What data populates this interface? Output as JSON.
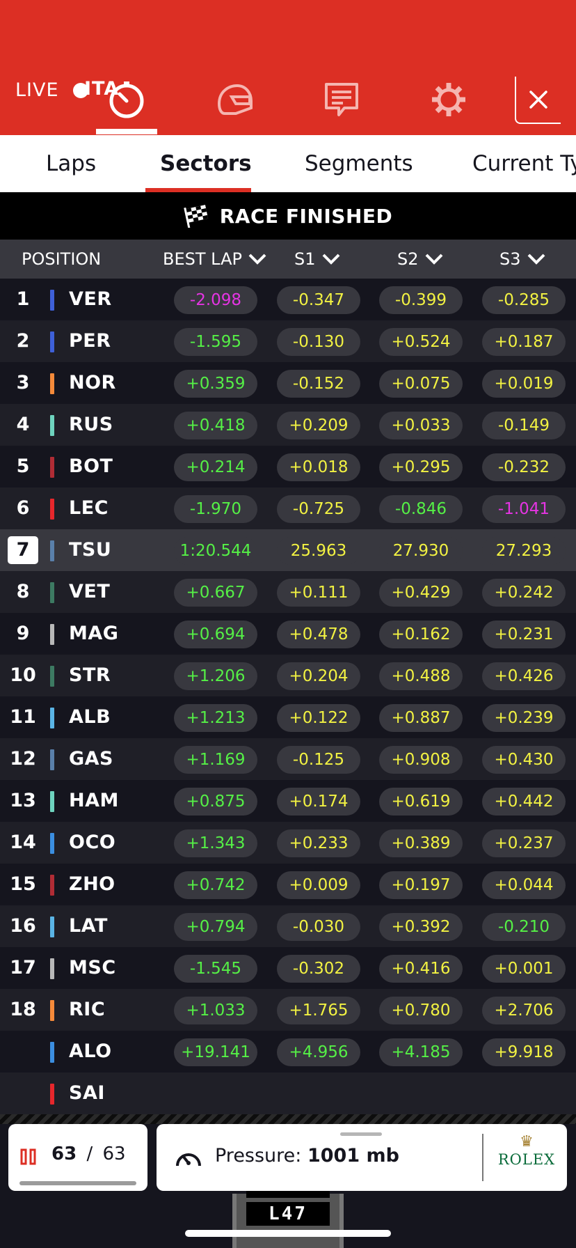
{
  "header": {
    "session_code": "ITA",
    "live_label": "LIVE",
    "icons": [
      "timer-icon",
      "helmet-icon",
      "chat-icon",
      "settings-icon",
      "close-icon"
    ],
    "colors": {
      "brand_red": "#dc2f24",
      "white": "#ffffff"
    }
  },
  "tabs": [
    {
      "label": "Laps"
    },
    {
      "label": "Sectors",
      "active": true
    },
    {
      "label": "Segments"
    },
    {
      "label": "Current Ty"
    }
  ],
  "status": {
    "text": "RACE FINISHED",
    "icon": "checkered-flag-icon"
  },
  "columns": {
    "position": "POSITION",
    "best_lap": "BEST LAP",
    "s1": "S1",
    "s2": "S2",
    "s3": "S3"
  },
  "value_colors": {
    "green": "#55f046",
    "yellow": "#f2f242",
    "purple": "#e534e3"
  },
  "drivers": [
    {
      "pos": "1",
      "code": "VER",
      "team_color": "#3e60d8",
      "best": "-2.098",
      "best_c": "purple",
      "s1": "-0.347",
      "s1_c": "yellow",
      "s2": "-0.399",
      "s2_c": "yellow",
      "s3": "-0.285",
      "s3_c": "yellow"
    },
    {
      "pos": "2",
      "code": "PER",
      "team_color": "#3e60d8",
      "best": "-1.595",
      "best_c": "green",
      "s1": "-0.130",
      "s1_c": "yellow",
      "s2": "+0.524",
      "s2_c": "yellow",
      "s3": "+0.187",
      "s3_c": "yellow"
    },
    {
      "pos": "3",
      "code": "NOR",
      "team_color": "#f58a3a",
      "best": "+0.359",
      "best_c": "green",
      "s1": "-0.152",
      "s1_c": "yellow",
      "s2": "+0.075",
      "s2_c": "yellow",
      "s3": "+0.019",
      "s3_c": "yellow"
    },
    {
      "pos": "4",
      "code": "RUS",
      "team_color": "#6ed3be",
      "best": "+0.418",
      "best_c": "green",
      "s1": "+0.209",
      "s1_c": "yellow",
      "s2": "+0.033",
      "s2_c": "yellow",
      "s3": "-0.149",
      "s3_c": "yellow"
    },
    {
      "pos": "5",
      "code": "BOT",
      "team_color": "#b02c35",
      "best": "+0.214",
      "best_c": "green",
      "s1": "+0.018",
      "s1_c": "yellow",
      "s2": "+0.295",
      "s2_c": "yellow",
      "s3": "-0.232",
      "s3_c": "yellow"
    },
    {
      "pos": "6",
      "code": "LEC",
      "team_color": "#e6272c",
      "best": "-1.970",
      "best_c": "green",
      "s1": "-0.725",
      "s1_c": "yellow",
      "s2": "-0.846",
      "s2_c": "green",
      "s3": "-1.041",
      "s3_c": "purple"
    },
    {
      "pos": "7",
      "code": "TSU",
      "team_color": "#5a80aa",
      "best": "1:20.544",
      "best_c": "green",
      "s1": "25.963",
      "s1_c": "yellow",
      "s2": "27.930",
      "s2_c": "yellow",
      "s3": "27.293",
      "s3_c": "yellow",
      "highlight": true
    },
    {
      "pos": "8",
      "code": "VET",
      "team_color": "#3d7a62",
      "best": "+0.667",
      "best_c": "green",
      "s1": "+0.111",
      "s1_c": "yellow",
      "s2": "+0.429",
      "s2_c": "yellow",
      "s3": "+0.242",
      "s3_c": "yellow"
    },
    {
      "pos": "9",
      "code": "MAG",
      "team_color": "#b8b8b8",
      "best": "+0.694",
      "best_c": "green",
      "s1": "+0.478",
      "s1_c": "yellow",
      "s2": "+0.162",
      "s2_c": "yellow",
      "s3": "+0.231",
      "s3_c": "yellow"
    },
    {
      "pos": "10",
      "code": "STR",
      "team_color": "#3d7a62",
      "best": "+1.206",
      "best_c": "green",
      "s1": "+0.204",
      "s1_c": "yellow",
      "s2": "+0.488",
      "s2_c": "yellow",
      "s3": "+0.426",
      "s3_c": "yellow"
    },
    {
      "pos": "11",
      "code": "ALB",
      "team_color": "#5ab4e5",
      "best": "+1.213",
      "best_c": "green",
      "s1": "+0.122",
      "s1_c": "yellow",
      "s2": "+0.887",
      "s2_c": "yellow",
      "s3": "+0.239",
      "s3_c": "yellow"
    },
    {
      "pos": "12",
      "code": "GAS",
      "team_color": "#5a80aa",
      "best": "+1.169",
      "best_c": "green",
      "s1": "-0.125",
      "s1_c": "yellow",
      "s2": "+0.908",
      "s2_c": "yellow",
      "s3": "+0.430",
      "s3_c": "yellow"
    },
    {
      "pos": "13",
      "code": "HAM",
      "team_color": "#6ed3be",
      "best": "+0.875",
      "best_c": "green",
      "s1": "+0.174",
      "s1_c": "yellow",
      "s2": "+0.619",
      "s2_c": "yellow",
      "s3": "+0.442",
      "s3_c": "yellow"
    },
    {
      "pos": "14",
      "code": "OCO",
      "team_color": "#3b8ee0",
      "best": "+1.343",
      "best_c": "green",
      "s1": "+0.233",
      "s1_c": "yellow",
      "s2": "+0.389",
      "s2_c": "yellow",
      "s3": "+0.237",
      "s3_c": "yellow"
    },
    {
      "pos": "15",
      "code": "ZHO",
      "team_color": "#b02c35",
      "best": "+0.742",
      "best_c": "green",
      "s1": "+0.009",
      "s1_c": "yellow",
      "s2": "+0.197",
      "s2_c": "yellow",
      "s3": "+0.044",
      "s3_c": "yellow"
    },
    {
      "pos": "16",
      "code": "LAT",
      "team_color": "#5ab4e5",
      "best": "+0.794",
      "best_c": "green",
      "s1": "-0.030",
      "s1_c": "yellow",
      "s2": "+0.392",
      "s2_c": "yellow",
      "s3": "-0.210",
      "s3_c": "green"
    },
    {
      "pos": "17",
      "code": "MSC",
      "team_color": "#b8b8b8",
      "best": "-1.545",
      "best_c": "green",
      "s1": "-0.302",
      "s1_c": "yellow",
      "s2": "+0.416",
      "s2_c": "yellow",
      "s3": "+0.001",
      "s3_c": "yellow"
    },
    {
      "pos": "18",
      "code": "RIC",
      "team_color": "#f58a3a",
      "best": "+1.033",
      "best_c": "green",
      "s1": "+1.765",
      "s1_c": "yellow",
      "s2": "+0.780",
      "s2_c": "yellow",
      "s3": "+2.706",
      "s3_c": "yellow"
    },
    {
      "pos": "",
      "code": "ALO",
      "team_color": "#3b8ee0",
      "best": "+19.141",
      "best_c": "green",
      "s1": "+4.956",
      "s1_c": "green",
      "s2": "+4.185",
      "s2_c": "green",
      "s3": "+9.918",
      "s3_c": "yellow"
    },
    {
      "pos": "",
      "code": "SAI",
      "team_color": "#e6272c",
      "best": "",
      "best_c": "green",
      "s1": "",
      "s1_c": "yellow",
      "s2": "",
      "s2_c": "yellow",
      "s3": "",
      "s3_c": "yellow"
    }
  ],
  "footer": {
    "lap_current": "63",
    "lap_separator": "/",
    "lap_total": "63",
    "pressure_label": "Pressure:",
    "pressure_value": "1001 mb",
    "sponsor": "ROLEX",
    "lap_sign": "L47"
  }
}
